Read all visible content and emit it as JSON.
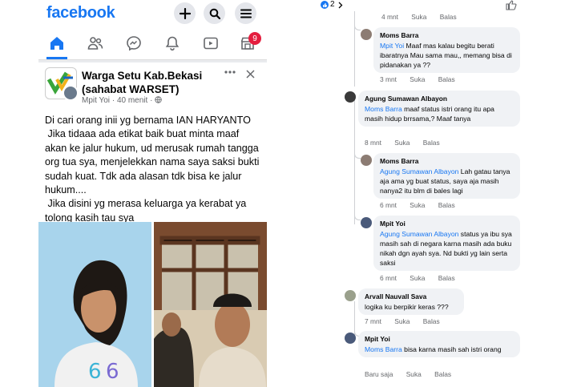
{
  "facebook": {
    "logo": "facebook",
    "notification_count": "9",
    "post": {
      "group_name": "Warga Setu Kab.Bekasi (sahabat WARSET)",
      "author": "Mpit Yoi",
      "time": "40 menit",
      "separator": "·",
      "body": "Di cari orang inii yg bernama IAN HARYANTO\n Jika tidaaa ada etikat baik buat minta maaf akan ke jalur hukum, ud merusak rumah tangga org tua sya, menjelekkan nama saya saksi bukti sudah kuat. Tdk ada alasan tdk bisa ke jalur hukum....\n Jika disini yg merasa keluarga ya kerabat ya tolong kasih tau sya"
    }
  },
  "comments_panel": {
    "top_reactions": "2",
    "first_actions": {
      "time": "4 mnt",
      "like": "Suka",
      "reply": "Balas"
    },
    "comments": [
      {
        "name": "Moms Barra",
        "tag": "Mpit Yoi",
        "text": " Maaf mas kalau begitu berati ibaratnya Mau sama mau,, memang bisa di pidanakan ya ??",
        "time": "3 mnt",
        "like": "Suka",
        "reply": "Balas"
      },
      {
        "name": "Agung Sumawan Albayon",
        "tag": "Moms Barra",
        "text": "  maaf status istri orang itu apa masih hidup brrsama,? Maaf tanya",
        "time": "8 mnt",
        "like": "Suka",
        "reply": "Balas"
      },
      {
        "name": "Moms Barra",
        "tag": "Agung Sumawan Albayon",
        "text": " Lah gatau tanya aja ama yg buat status, saya aja masih nanya2 itu blm di bales lagi",
        "time": "6 mnt",
        "like": "Suka",
        "reply": "Balas"
      },
      {
        "name": "Mpit Yoi",
        "tag": "Agung Sumawan Albayon",
        "text": " status ya ibu sya masih sah di negara karna masih ada buku nikah dgn ayah sya. Nd bukti yg lain serta saksi",
        "time": "6 mnt",
        "like": "Suka",
        "reply": "Balas"
      },
      {
        "name": "Arvall Nauvall Sava",
        "tag": "",
        "text": "logika ku berpikir keras ???",
        "time": "7 mnt",
        "like": "Suka",
        "reply": "Balas"
      },
      {
        "name": "Mpit Yoi",
        "tag": "Moms Barra",
        "text": " bisa karna masih sah istri orang",
        "time": "Baru saja",
        "like": "Suka",
        "reply": "Balas"
      }
    ]
  },
  "colors": {
    "brand": "#1877f2",
    "badge": "#e41e3f",
    "bubble": "#f0f2f5"
  }
}
